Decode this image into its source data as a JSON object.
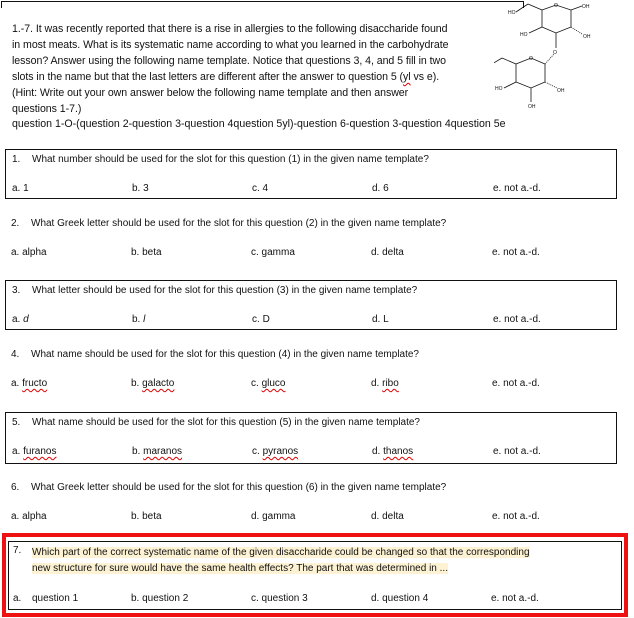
{
  "intro": {
    "lines": [
      "1.-7.  It was recently reported that there is a rise in allergies to the following disaccharide found",
      "in most meats.  What is its systematic name according to what you learned in the carbohydrate",
      "lesson?  Answer using the following name template.  Notice that questions 3, 4, and 5 fill in two"
    ],
    "line4_before": "slots in the name but that the last letters are different after the answer to question 5  (",
    "line4_yl": "yl",
    "line4_after": " vs e).",
    "line5": "(Hint:  Write out your own answer below the following name template and then answer",
    "line6": "questions 1-7.)",
    "template": "question 1-O-(question 2-question 3-question 4question 5yl)-question 6-question 3-question 4question 5e"
  },
  "molecule": {
    "labels": {
      "oh": "OH",
      "ho": "HO",
      "o": "O"
    }
  },
  "questions": [
    {
      "number": "1.",
      "text": "What number should be used for the slot for this question (1) in the given name template?",
      "boxed": true,
      "options": [
        "a. 1",
        "b. 3",
        "c. 4",
        "d. 6",
        "e. not a.-d."
      ]
    },
    {
      "number": "2.",
      "text": "What Greek letter should be used for the slot for this question (2) in the given name template?",
      "boxed": false,
      "options": [
        "a. alpha",
        "b. beta",
        "c. gamma",
        "d. delta",
        "e. not a.-d."
      ]
    },
    {
      "number": "3.",
      "text": "What letter should be used for the slot for this question (3) in the given name template?",
      "boxed": true,
      "option_prefixes": [
        "a. ",
        "b. ",
        "c. ",
        "d. ",
        "e. "
      ],
      "option_values": [
        "d",
        "l",
        "D",
        "L",
        "not a.-d."
      ]
    },
    {
      "number": "4.",
      "text": "What name should be used for the slot for this question (4) in the given name template?",
      "boxed": false,
      "option_prefixes": [
        "a. ",
        "b. ",
        "c. ",
        "d. ",
        "e. "
      ],
      "option_values": [
        "fructo",
        "galacto",
        "gluco",
        "ribo",
        "not a.-d."
      ]
    },
    {
      "number": "5.",
      "text": "What name should be used for the slot for this question (5) in the given name template?",
      "boxed": true,
      "option_prefixes": [
        "a. ",
        "b. ",
        "c. ",
        "d. ",
        "e. "
      ],
      "option_values": [
        "furanos",
        "maranos",
        "pyranos",
        "thanos",
        "not a.-d."
      ]
    },
    {
      "number": "6.",
      "text": "What Greek letter should be used for the slot for this question (6) in the given name template?",
      "boxed": false,
      "options": [
        "a. alpha",
        "b. beta",
        "d. gamma",
        "d. delta",
        "e. not a.-d."
      ]
    },
    {
      "number": "7.",
      "text_line1": "Which part of the correct systematic name of the given disaccharide could be changed so that the corresponding",
      "text_line2": "new structure for sure would have the same health effects?  The part that was determined in ...",
      "option_a_label": "a.",
      "option_a_value": "question 1",
      "options": [
        "b. question 2",
        "c. question 3",
        "d. question 4",
        "e. not a.-d."
      ]
    }
  ],
  "colors": {
    "highlight_box": "#ee1111",
    "text_highlight": "#fdf3d4",
    "spellcheck": "#dd0000"
  }
}
